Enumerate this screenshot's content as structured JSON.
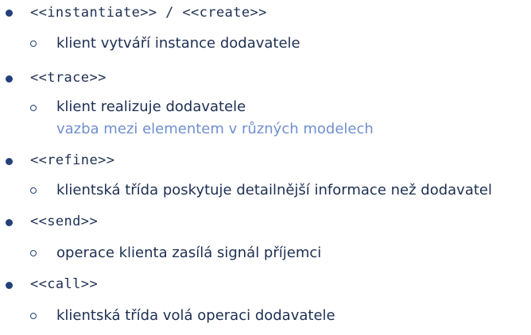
{
  "items": [
    {
      "stereotype": "<<instantiate>> / <<create>>",
      "description": "klient vytváří instance dodavatele"
    },
    {
      "stereotype": "<<trace>>",
      "description": "klient realizuje dodavatele",
      "note": "vazba mezi elementem v různých modelech"
    },
    {
      "stereotype": "<<refine>>",
      "description": "klientská třída poskytuje detailnější informace než dodavatel"
    },
    {
      "stereotype": "<<send>>",
      "description": "operace klienta zasílá signál příjemci"
    },
    {
      "stereotype": "<<call>>",
      "description": "klientská třída volá operaci dodavatele"
    }
  ]
}
